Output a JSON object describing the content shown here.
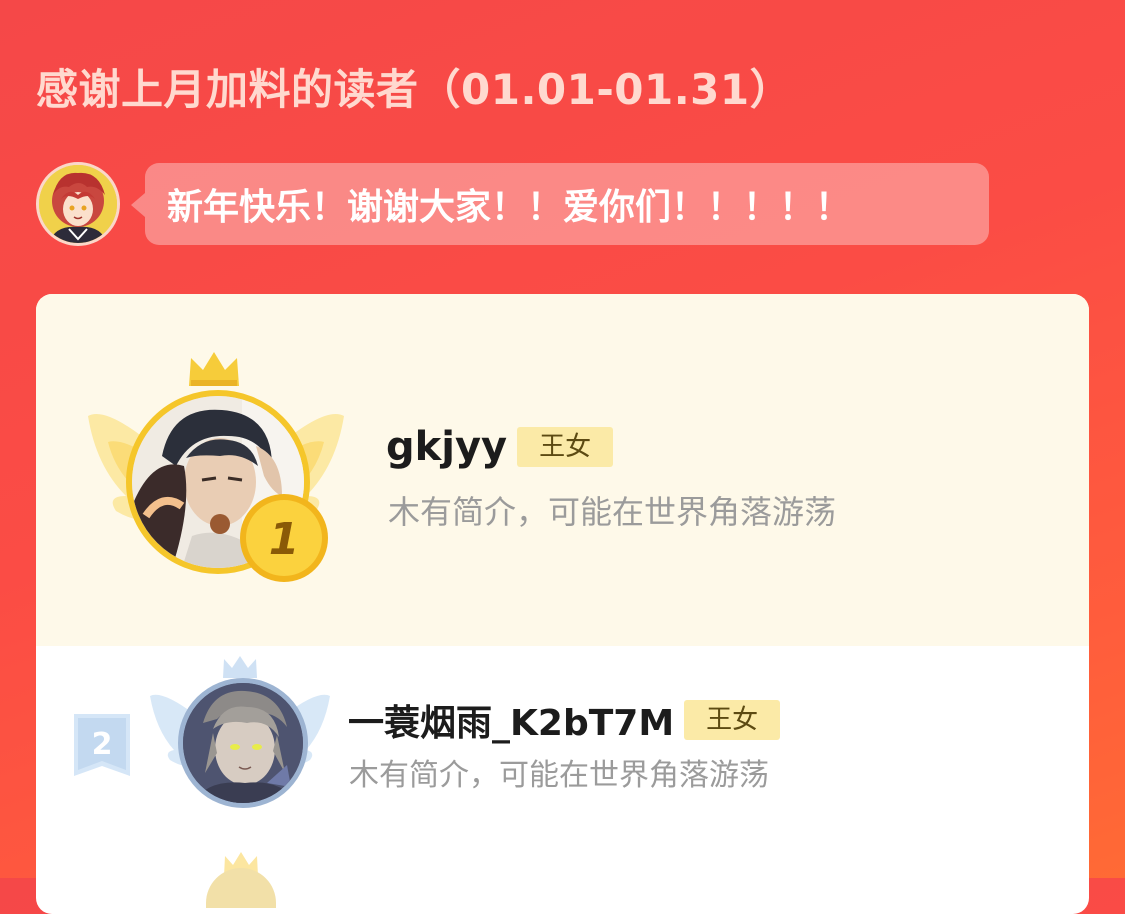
{
  "header": {
    "title": "感谢上月加料的读者（01.01-01.31）"
  },
  "author_message": {
    "text": "新年快乐！谢谢大家！！爱你们！！！！！"
  },
  "ranking": [
    {
      "rank": "1",
      "name": "gkjyy",
      "badge": "王女",
      "bio": "木有简介，可能在世界角落游荡"
    },
    {
      "rank": "2",
      "name": "一蓑烟雨_K2bT7M",
      "badge": "王女",
      "bio": "木有简介，可能在世界角落游荡"
    }
  ],
  "colors": {
    "background": "#f54848",
    "gold": "#f5c62a",
    "silver": "#c7dcf2",
    "card_top": "#fef9e9",
    "badge_bg": "#fbeaa7"
  },
  "icons": {
    "crown": "crown-icon",
    "wings": "wings-icon",
    "medal": "medal-icon",
    "ribbon": "rank-ribbon-icon"
  }
}
